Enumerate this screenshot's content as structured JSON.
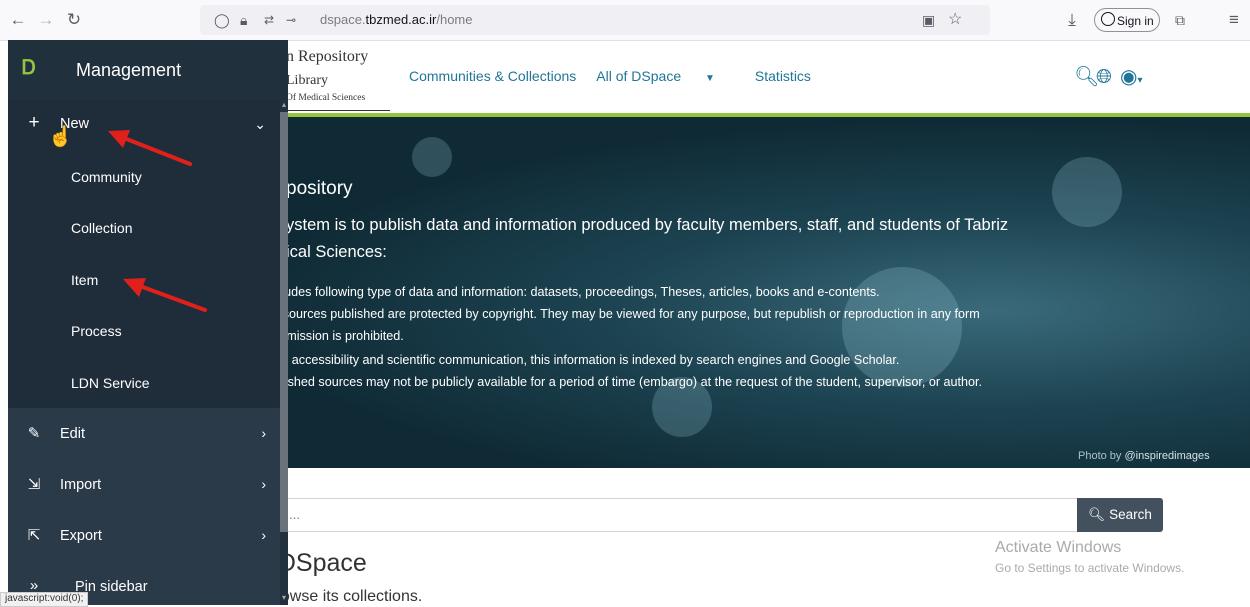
{
  "browser": {
    "url_prefix": "dspace.",
    "url_domain": "tbzmed.ac.ir",
    "url_path": "/home",
    "signin_label": "Sign in"
  },
  "header": {
    "logo_lines": [
      "n Repository",
      "Library",
      "Of Medical Sciences"
    ],
    "nav": [
      "Communities & Collections",
      "All of DSpace",
      "Statistics"
    ]
  },
  "hero": {
    "title": "pository",
    "line1": "ystem is to publish data and information produced by faculty members, staff, and students of Tabriz",
    "line2": "ical Sciences:",
    "bullets": [
      "ncludes following type of data and information: datasets, proceedings, Theses, articles, books and e-contents.",
      "or sources published are protected by copyright. They may be viewed for any purpose, but republish or reproduction in any form",
      "permission is prohibited.",
      "ase accessibility and scientific communication, this information is indexed by search engines and Google Scholar.",
      "ublished sources may not be publicly available for a period of time (embargo) at the request of the student, supervisor, or author."
    ],
    "credit_prefix": "Photo by ",
    "credit_name": "@inspiredimages"
  },
  "search": {
    "placeholder": "y ...",
    "button_label": "Search"
  },
  "communities": {
    "heading": "s in DSpace",
    "subtitle": "ty to browse its collections."
  },
  "activation": {
    "title": "Activate Windows",
    "subtitle": "Go to Settings to activate Windows."
  },
  "sidebar": {
    "title": "Management",
    "new_label": "New",
    "new_items": [
      "Community",
      "Collection",
      "Item",
      "Process",
      "LDN Service"
    ],
    "items": [
      {
        "label": "Edit",
        "icon": "pencil-icon"
      },
      {
        "label": "Import",
        "icon": "import-icon"
      },
      {
        "label": "Export",
        "icon": "export-icon"
      }
    ],
    "pin_label": "Pin sidebar"
  },
  "status_bar": "javascript:void(0);",
  "colors": {
    "sidebar_bg": "#2b3a48",
    "accent_green": "#92c642",
    "link_blue": "#207698",
    "annotation_red": "#e0201b"
  }
}
